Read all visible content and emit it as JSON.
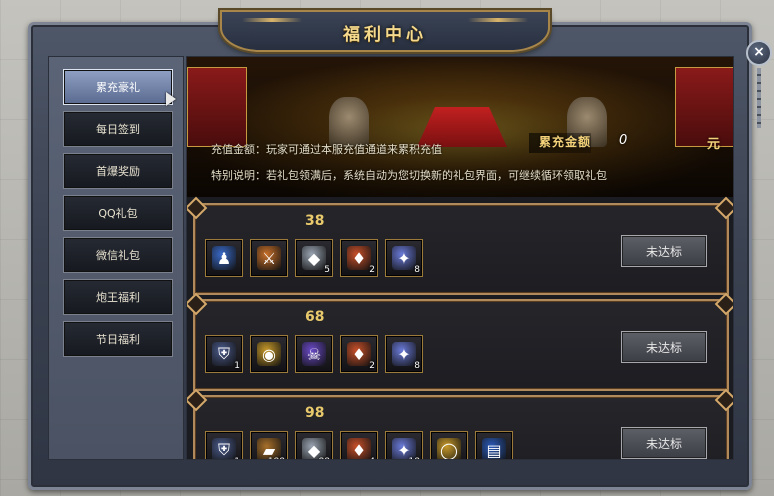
{
  "window": {
    "title": "福利中心",
    "close_label": "×"
  },
  "sidebar": {
    "items": [
      {
        "label": "累充豪礼",
        "active": true
      },
      {
        "label": "每日签到",
        "active": false
      },
      {
        "label": "首爆奖励",
        "active": false
      },
      {
        "label": "QQ礼包",
        "active": false
      },
      {
        "label": "微信礼包",
        "active": false
      },
      {
        "label": "炮王福利",
        "active": false
      },
      {
        "label": "节日福利",
        "active": false
      }
    ]
  },
  "banner": {
    "amount_label": "累充金额",
    "amount_value": "0",
    "amount_unit": "元",
    "desc_line1": "充值金额：玩家可通过本服充值通道来累积充值",
    "desc_line2": "特别说明：若礼包领满后，系统自动为您切换新的礼包界面，可继续循环领取礼包"
  },
  "tiers": [
    {
      "amount": "38",
      "status": "未达标",
      "items": [
        {
          "icon": "mage-figure-icon",
          "count": "",
          "color": "#3a6ac8"
        },
        {
          "icon": "warrior-figure-icon",
          "count": "",
          "color": "#c8702a"
        },
        {
          "icon": "silver-ore-icon",
          "count": "5",
          "color": "#9aa4b2"
        },
        {
          "icon": "fire-stone-icon",
          "count": "2",
          "color": "#c8502a"
        },
        {
          "icon": "crystal-gem-icon",
          "count": "8",
          "color": "#6a7ad8"
        }
      ]
    },
    {
      "amount": "68",
      "status": "未达标",
      "items": [
        {
          "icon": "armor-helmet-icon",
          "count": "1",
          "color": "#4a5a8a"
        },
        {
          "icon": "gold-token-icon",
          "count": "",
          "color": "#c89a2a"
        },
        {
          "icon": "demon-mask-icon",
          "count": "",
          "color": "#6a4ac8"
        },
        {
          "icon": "fire-stone-icon",
          "count": "2",
          "color": "#c8502a"
        },
        {
          "icon": "crystal-gem-icon",
          "count": "8",
          "color": "#6a7ad8"
        }
      ]
    },
    {
      "amount": "98",
      "status": "未达标",
      "items": [
        {
          "icon": "armor-helmet-icon",
          "count": "1",
          "color": "#4a5a8a"
        },
        {
          "icon": "gold-ingot-icon",
          "count": "188",
          "color": "#a8702a"
        },
        {
          "icon": "silver-ore-icon",
          "count": "88",
          "color": "#9aa4b2"
        },
        {
          "icon": "fire-stone-icon",
          "count": "4",
          "color": "#c8502a"
        },
        {
          "icon": "crystal-gem-icon",
          "count": "18",
          "color": "#6a7ad8"
        },
        {
          "icon": "gold-ring-icon",
          "count": "",
          "color": "#c89a2a"
        },
        {
          "icon": "blue-book-icon",
          "count": "",
          "color": "#2a5ab8"
        }
      ]
    }
  ]
}
